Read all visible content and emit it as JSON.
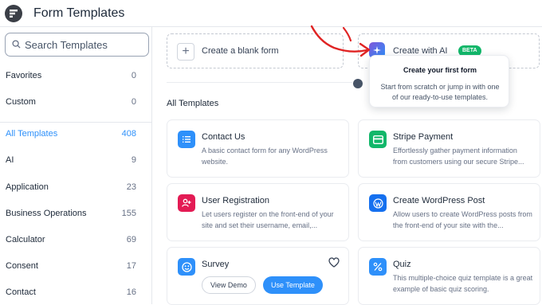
{
  "header": {
    "title": "Form Templates"
  },
  "sidebar": {
    "search_placeholder": "Search Templates",
    "items": [
      {
        "label": "Favorites",
        "count": "0"
      },
      {
        "label": "Custom",
        "count": "0"
      },
      {
        "label": "All Templates",
        "count": "408",
        "active": true
      },
      {
        "label": "AI",
        "count": "9"
      },
      {
        "label": "Application",
        "count": "23"
      },
      {
        "label": "Business Operations",
        "count": "155"
      },
      {
        "label": "Calculator",
        "count": "69"
      },
      {
        "label": "Consent",
        "count": "17"
      },
      {
        "label": "Contact",
        "count": "16"
      }
    ]
  },
  "main": {
    "blank_form_label": "Create a blank form",
    "ai_label": "Create with AI",
    "ai_badge": "BETA",
    "tooltip": {
      "title": "Create your first form",
      "description": "Start from scratch or jump in with one of our ready-to-use templates."
    },
    "section_title": "All Templates",
    "templates": [
      {
        "name": "Contact Us",
        "description": "A basic contact form for any WordPress website.",
        "icon": "list-icon",
        "color": "#2e90fa"
      },
      {
        "name": "Stripe Payment",
        "description": "Effortlessly gather payment information from customers using our secure Stripe...",
        "icon": "credit-card-icon",
        "color": "#12b76a"
      },
      {
        "name": "User Registration",
        "description": "Let users register on the front-end of your site and set their username, email,...",
        "icon": "user-plus-icon",
        "color": "#e31b54"
      },
      {
        "name": "Create WordPress Post",
        "description": "Allow users to create WordPress posts from the front-end of your site with the...",
        "icon": "wordpress-icon",
        "color": "#1570ef"
      },
      {
        "name": "Survey",
        "description": "",
        "icon": "smile-icon",
        "color": "#2e90fa",
        "view_demo": "View Demo",
        "use_template": "Use Template"
      },
      {
        "name": "Quiz",
        "description": "This multiple-choice quiz template is a great example of basic quiz scoring.",
        "icon": "percent-icon",
        "color": "#2e90fa"
      }
    ]
  },
  "colors": {
    "accent": "#2e90fa",
    "beta": "#12b76a",
    "annotation_arrow": "#e02424"
  }
}
